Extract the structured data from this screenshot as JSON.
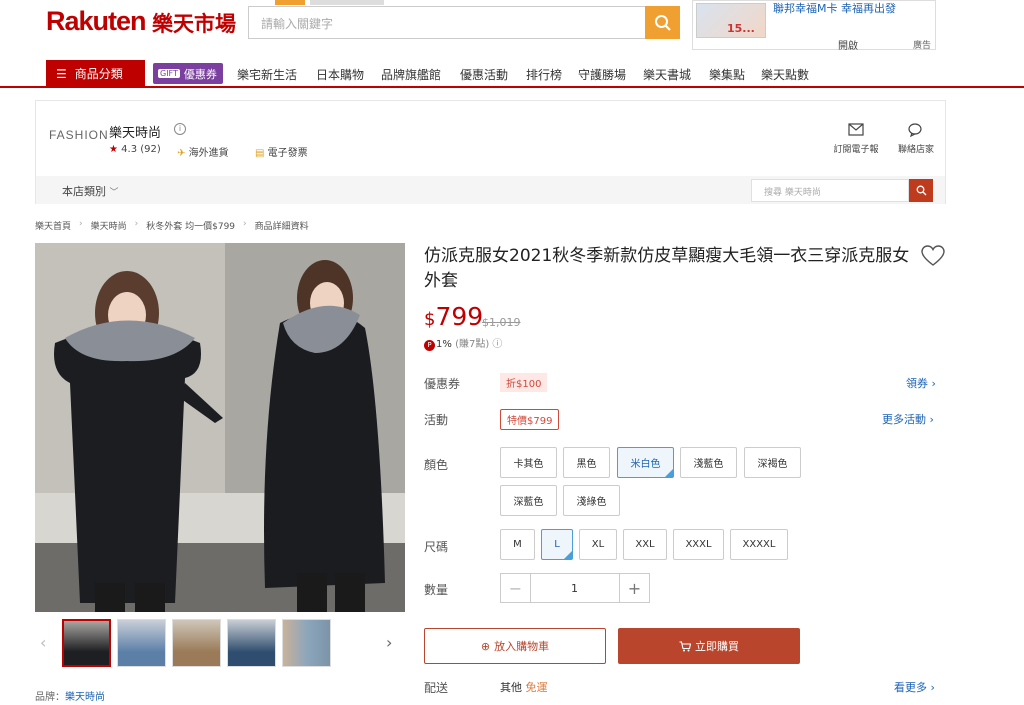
{
  "header": {
    "logo_text": "Rakuten",
    "logo_cn": "樂天市場",
    "search_placeholder": "請輸入關鍵字",
    "ad": {
      "title": "聯邦幸福M卡 幸福再出發",
      "price_text": "15...",
      "open_label": "開啟",
      "tag": "廣告"
    },
    "nav": {
      "category_label": "商品分類",
      "coupon_gift": "GIFT",
      "coupon_label": "優惠券",
      "links": [
        "樂宅新生活",
        "日本購物",
        "品牌旗艦館",
        "優惠活動",
        "排行榜",
        "守護勝場",
        "樂天書城",
        "樂集點",
        "樂天點數"
      ]
    }
  },
  "store": {
    "logo": "FASHION",
    "name": "樂天時尚",
    "rating": "4.3",
    "rating_count": "(92)",
    "tag_overseas": "海外進貨",
    "tag_invoice": "電子發票",
    "subscribe_label": "訂閱電子報",
    "contact_label": "聯絡店家",
    "category_label": "本店類別",
    "search_placeholder": "搜尋 樂天時尚"
  },
  "breadcrumb": [
    "樂天首頁",
    "樂天時尚",
    "秋冬外套 均一價$799",
    "商品詳細資料"
  ],
  "product": {
    "title": "仿派克服女2021秋冬季新款仿皮草顯瘦大毛領一衣三穿派克服女外套",
    "price_currency": "$",
    "price": "799",
    "original_price": "$1,019",
    "points_rate": "1%",
    "points_note": "(賺7點)",
    "brand_label": "品牌：",
    "brand": "樂天時尚",
    "coupon_label": "優惠券",
    "coupon_tag": "折$100",
    "coupon_more": "領券",
    "event_label": "活動",
    "event_tag": "特價$799",
    "event_more": "更多活動",
    "color_label": "顏色",
    "colors": [
      "卡其色",
      "黑色",
      "米白色",
      "淺藍色",
      "深褐色",
      "深藍色",
      "淺綠色"
    ],
    "selected_color": "米白色",
    "size_label": "尺碼",
    "sizes": [
      "M",
      "L",
      "XL",
      "XXL",
      "XXXL",
      "XXXXL"
    ],
    "selected_size": "L",
    "qty_label": "數量",
    "qty": "1",
    "add_cart_label": "放入購物車",
    "buy_now_label": "立即購買",
    "ship_label": "配送",
    "ship_other": "其他",
    "ship_free": "免運",
    "ship_more": "看更多"
  },
  "colors": {
    "brand_red": "#bf0000",
    "accent_orange": "#f0a030",
    "button_rust": "#b8452c",
    "link_blue": "#1d63b5"
  }
}
